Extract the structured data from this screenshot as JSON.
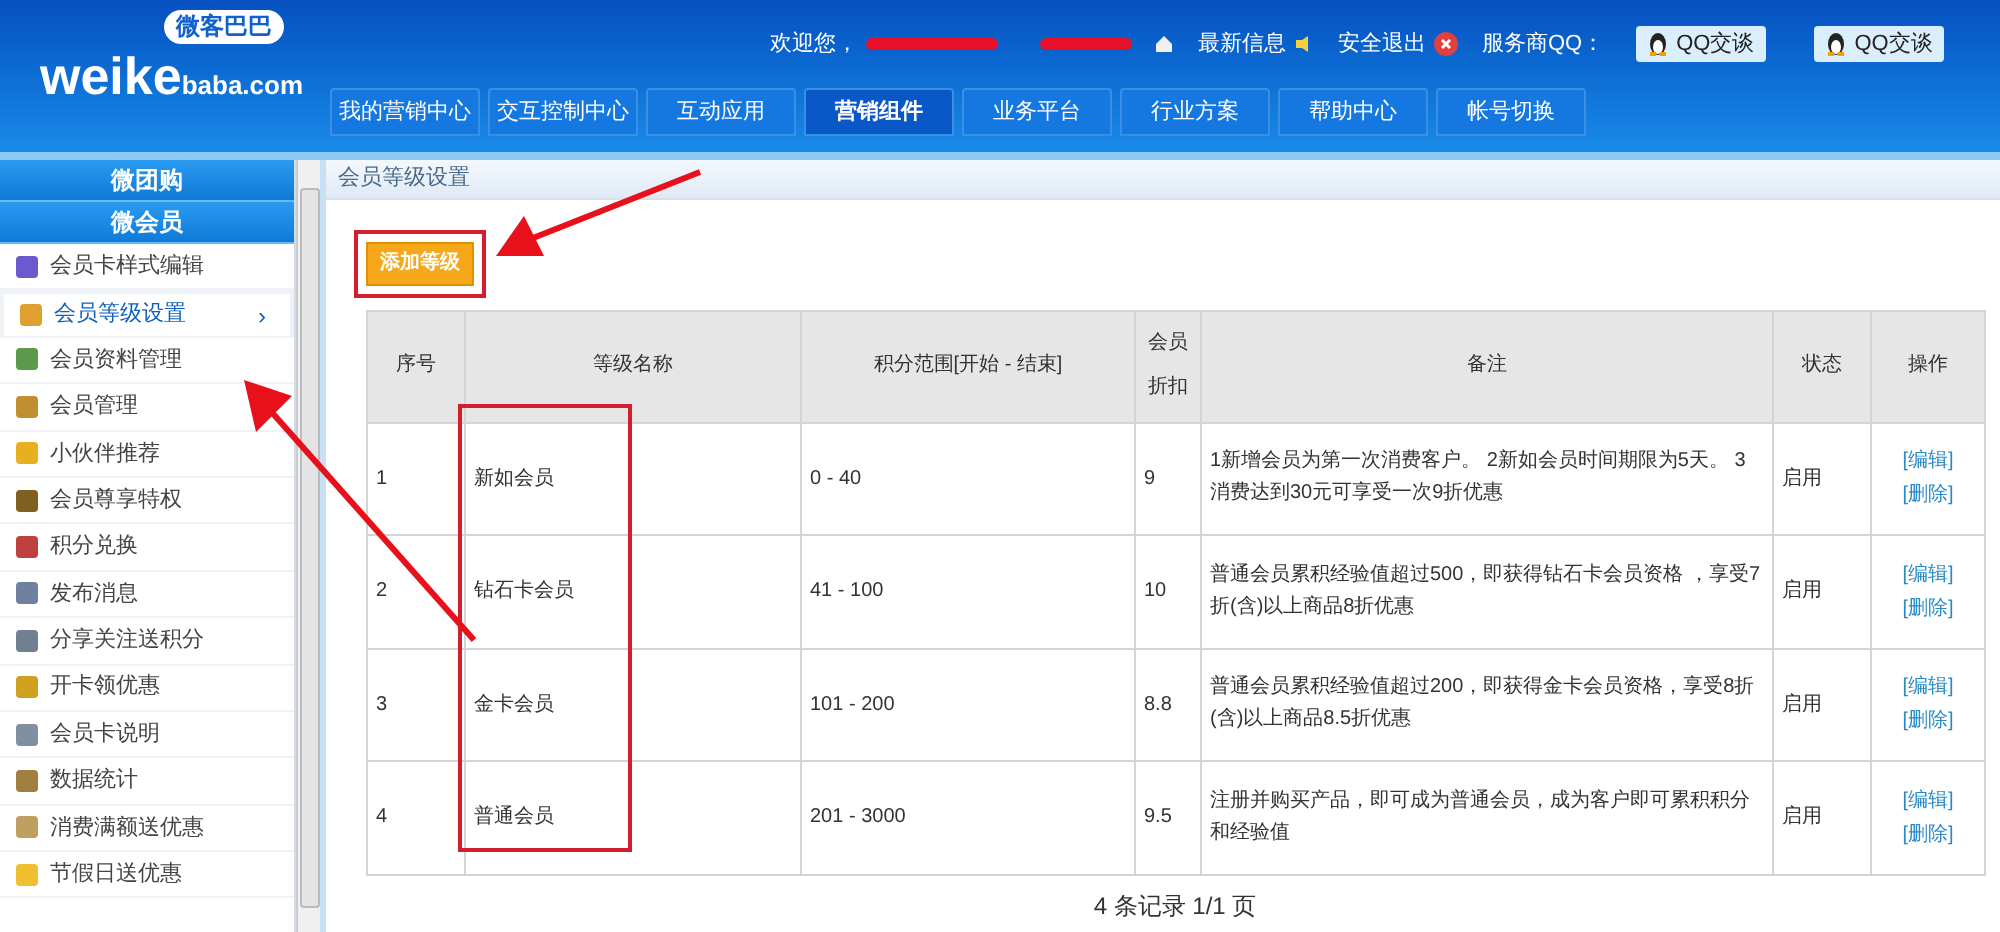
{
  "header": {
    "logo_main": "weike",
    "logo_suffix": "baba.com",
    "logo_badge": "微客巴巴",
    "welcome": "欢迎您，",
    "links": [
      {
        "label": "最新信息",
        "kind": "speaker"
      },
      {
        "label": "安全退出",
        "kind": "exit"
      }
    ],
    "service_label": "服务商QQ：",
    "qq_buttons": [
      "QQ交谈",
      "QQ交谈"
    ]
  },
  "nav": [
    {
      "label": "我的营销中心",
      "selected": false
    },
    {
      "label": "交互控制中心",
      "selected": false
    },
    {
      "label": "互动应用",
      "selected": false
    },
    {
      "label": "营销组件",
      "selected": true
    },
    {
      "label": "业务平台",
      "selected": false
    },
    {
      "label": "行业方案",
      "selected": false
    },
    {
      "label": "帮助中心",
      "selected": false
    },
    {
      "label": "帐号切换",
      "selected": false
    }
  ],
  "sidebar": {
    "groups": [
      "微团购",
      "微会员"
    ],
    "items": [
      {
        "label": "会员卡样式编辑",
        "selected": false,
        "color": "#6a5acd"
      },
      {
        "label": "会员等级设置",
        "selected": true,
        "color": "#e0a030",
        "chevron": "›"
      },
      {
        "label": "会员资料管理",
        "selected": false,
        "color": "#5a9a4a"
      },
      {
        "label": "会员管理",
        "selected": false,
        "color": "#c09030"
      },
      {
        "label": "小伙伴推荐",
        "selected": false,
        "color": "#e8b020"
      },
      {
        "label": "会员尊享特权",
        "selected": false,
        "color": "#806020"
      },
      {
        "label": "积分兑换",
        "selected": false,
        "color": "#c04040"
      },
      {
        "label": "发布消息",
        "selected": false,
        "color": "#7080a0"
      },
      {
        "label": "分享关注送积分",
        "selected": false,
        "color": "#708090"
      },
      {
        "label": "开卡领优惠",
        "selected": false,
        "color": "#d0a020"
      },
      {
        "label": "会员卡说明",
        "selected": false,
        "color": "#8090a0"
      },
      {
        "label": "数据统计",
        "selected": false,
        "color": "#a08040"
      },
      {
        "label": "消费满额送优惠",
        "selected": false,
        "color": "#c0a060"
      },
      {
        "label": "节假日送优惠",
        "selected": false,
        "color": "#f0c030"
      }
    ]
  },
  "breadcrumb": "会员等级设置",
  "add_button": "添加等级",
  "table": {
    "columns": [
      "序号",
      "等级名称",
      "积分范围[开始 - 结束]",
      "会员折扣",
      "备注",
      "状态",
      "操作"
    ],
    "rows": [
      {
        "no": "1",
        "name": "新如会员",
        "range": "0 - 40",
        "discount": "9",
        "note": "1新增会员为第一次消费客户。 2新如会员时间期限为5天。 3消费达到30元可享受一次9折优惠",
        "status": "启用",
        "actions": [
          "[编辑]",
          "[删除]"
        ]
      },
      {
        "no": "2",
        "name": "钻石卡会员",
        "range": "41 - 100",
        "discount": "10",
        "note": "普通会员累积经验值超过500，即获得钻石卡会员资格 ，享受7折(含)以上商品8折优惠",
        "status": "启用",
        "actions": [
          "[编辑]",
          "[删除]"
        ]
      },
      {
        "no": "3",
        "name": "金卡会员",
        "range": "101 - 200",
        "discount": "8.8",
        "note": "普通会员累积经验值超过200，即获得金卡会员资格，享受8折(含)以上商品8.5折优惠",
        "status": "启用",
        "actions": [
          "[编辑]",
          "[删除]"
        ]
      },
      {
        "no": "4",
        "name": "普通会员",
        "range": "201 - 3000",
        "discount": "9.5",
        "note": "注册并购买产品，即可成为普通会员，成为客户即可累积积分和经验值",
        "status": "启用",
        "actions": [
          "[编辑]",
          "[删除]"
        ]
      }
    ]
  },
  "pagination": "4 条记录 1/1 页"
}
